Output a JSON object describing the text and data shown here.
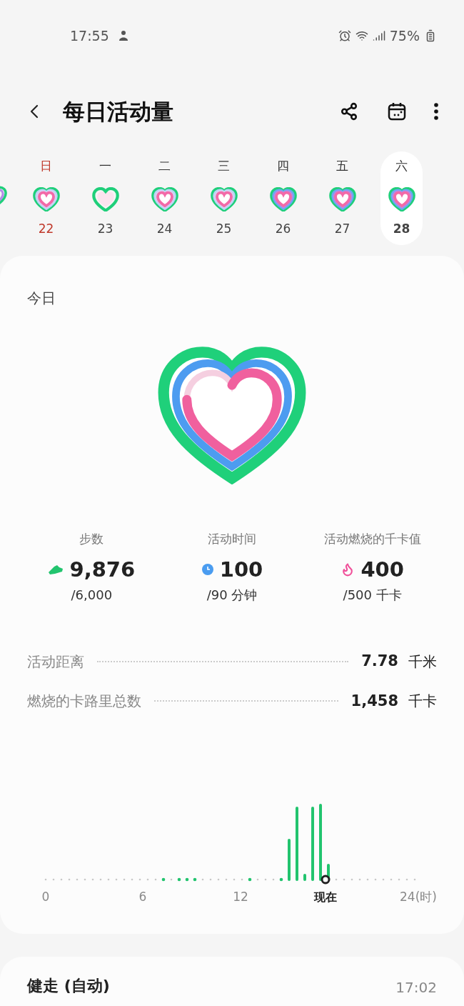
{
  "status_bar": {
    "time": "17:55",
    "battery": "75%"
  },
  "header": {
    "title": "每日活动量"
  },
  "week": [
    {
      "weekday": "日",
      "date": "22",
      "holiday": true,
      "selected": false,
      "kind": "partial"
    },
    {
      "weekday": "一",
      "date": "23",
      "holiday": false,
      "selected": false,
      "kind": "empty"
    },
    {
      "weekday": "二",
      "date": "24",
      "holiday": false,
      "selected": false,
      "kind": "partial"
    },
    {
      "weekday": "三",
      "date": "25",
      "holiday": false,
      "selected": false,
      "kind": "partial"
    },
    {
      "weekday": "四",
      "date": "26",
      "holiday": false,
      "selected": false,
      "kind": "full"
    },
    {
      "weekday": "五",
      "date": "27",
      "holiday": false,
      "selected": false,
      "kind": "full"
    },
    {
      "weekday": "六",
      "date": "28",
      "holiday": false,
      "selected": true,
      "kind": "full"
    }
  ],
  "today": {
    "title": "今日",
    "stats": [
      {
        "kind": "steps",
        "label": "步数",
        "value": "9,876",
        "goal": "/6,000"
      },
      {
        "kind": "time",
        "label": "活动时间",
        "value": "100",
        "goal": "/90 分钟"
      },
      {
        "kind": "calories",
        "label": "活动燃烧的千卡值",
        "value": "400",
        "goal": "/500 千卡"
      }
    ],
    "rows": [
      {
        "label": "活动距离",
        "value": "7.78",
        "unit": "千米"
      },
      {
        "label": "燃烧的卡路里总数",
        "value": "1,458",
        "unit": "千卡"
      }
    ],
    "chart": {
      "axis_labels": [
        "0",
        "6",
        "12",
        "24(时)"
      ],
      "now_label": "现在"
    }
  },
  "activity": {
    "title": "健走 (自动)",
    "time": "17:02"
  }
}
